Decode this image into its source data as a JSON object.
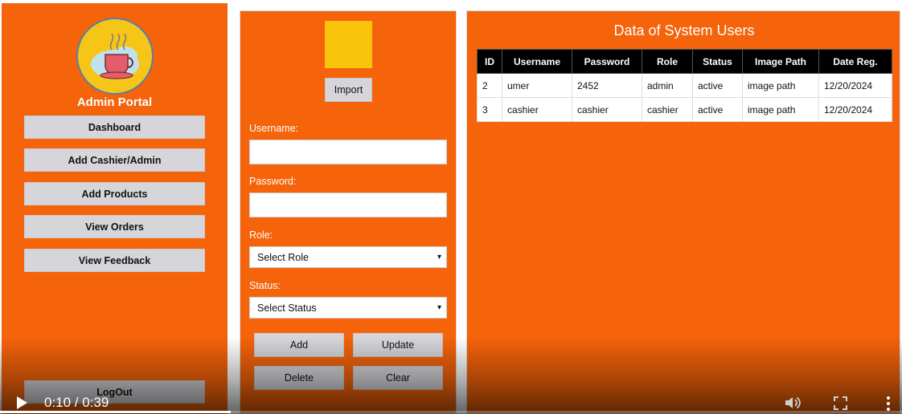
{
  "sidebar": {
    "title": "Admin Portal",
    "items": [
      {
        "label": "Dashboard"
      },
      {
        "label": "Add Cashier/Admin"
      },
      {
        "label": "Add Products"
      },
      {
        "label": "View Orders"
      },
      {
        "label": "View Feedback"
      }
    ],
    "logout_label": "LogOut",
    "logo_icon": "coffee-cup-icon"
  },
  "form": {
    "import_label": "Import",
    "username_label": "Username:",
    "username_value": "",
    "password_label": "Password:",
    "password_value": "",
    "role_label": "Role:",
    "role_selected": "Select Role",
    "status_label": "Status:",
    "status_selected": "Select Status",
    "buttons": {
      "add": "Add",
      "update": "Update",
      "delete": "Delete",
      "clear": "Clear"
    }
  },
  "table": {
    "title": "Data of System Users",
    "columns": [
      "ID",
      "Username",
      "Password",
      "Role",
      "Status",
      "Image Path",
      "Date Reg."
    ],
    "rows": [
      [
        "2",
        "umer",
        "2452",
        "admin",
        "active",
        "image path",
        "12/20/2024"
      ],
      [
        "3",
        "cashier",
        "cashier",
        "cashier",
        "active",
        "image path",
        "12/20/2024"
      ]
    ]
  },
  "video": {
    "time_display": "0:10 / 0:39",
    "progress": 0.256
  },
  "colors": {
    "panel_orange": "#f5630a",
    "image_placeholder": "#fbc40c",
    "button_gray": "#d6d6da"
  }
}
